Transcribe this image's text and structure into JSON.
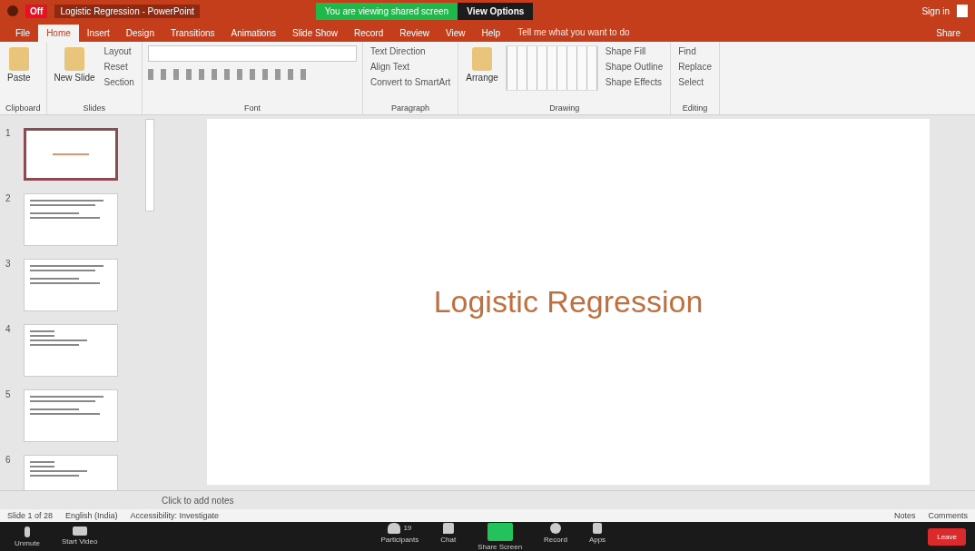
{
  "share_banner": {
    "message": "You are viewing shared screen",
    "options": "View Options"
  },
  "title_bar": {
    "save_badge": "Off",
    "title": "Logistic Regression - PowerPoint",
    "user": "Sign in"
  },
  "tabs": [
    {
      "label": "File",
      "selected": false
    },
    {
      "label": "Home",
      "selected": true
    },
    {
      "label": "Insert",
      "selected": false
    },
    {
      "label": "Design",
      "selected": false
    },
    {
      "label": "Transitions",
      "selected": false
    },
    {
      "label": "Animations",
      "selected": false
    },
    {
      "label": "Slide Show",
      "selected": false
    },
    {
      "label": "Record",
      "selected": false
    },
    {
      "label": "Review",
      "selected": false
    },
    {
      "label": "View",
      "selected": false
    },
    {
      "label": "Help",
      "selected": false
    }
  ],
  "tell_me": {
    "placeholder": "Tell me what you want to do"
  },
  "share_button": "Share",
  "ribbon": {
    "groups": [
      {
        "label": "Clipboard",
        "large": [
          "Paste"
        ]
      },
      {
        "label": "Slides",
        "large": [
          "New Slide"
        ],
        "small": [
          "Layout",
          "Reset",
          "Section"
        ]
      },
      {
        "label": "Font"
      },
      {
        "label": "Paragraph",
        "small": [
          "Text Direction",
          "Align Text",
          "Convert to SmartArt"
        ]
      },
      {
        "label": "Drawing",
        "large": [
          "Arrange"
        ],
        "small": [
          "Shape Fill",
          "Shape Outline",
          "Shape Effects"
        ]
      },
      {
        "label": "Editing",
        "small": [
          "Find",
          "Replace",
          "Select"
        ]
      }
    ]
  },
  "thumbnails": [
    {
      "number": "1",
      "selected": true,
      "kind": "title"
    },
    {
      "number": "2",
      "selected": false,
      "kind": "text"
    },
    {
      "number": "3",
      "selected": false,
      "kind": "text"
    },
    {
      "number": "4",
      "selected": false,
      "kind": "list"
    },
    {
      "number": "5",
      "selected": false,
      "kind": "text"
    },
    {
      "number": "6",
      "selected": false,
      "kind": "list"
    }
  ],
  "slide": {
    "title": "Logistic Regression"
  },
  "notes": {
    "placeholder": "Click to add notes"
  },
  "status_bar": {
    "left": [
      "Slide 1 of 28",
      "English (India)",
      "Accessibility: Investigate"
    ],
    "right": [
      "Notes",
      "Comments"
    ]
  },
  "meeting_bar": {
    "left": [
      {
        "label": "Unmute",
        "kind": "mic"
      },
      {
        "label": "Start Video",
        "kind": "video"
      }
    ],
    "center": [
      {
        "label": "Participants",
        "kind": "people",
        "count": "19"
      },
      {
        "label": "Chat",
        "kind": "chat"
      },
      {
        "label": "Share Screen",
        "kind": "share"
      },
      {
        "label": "Record",
        "kind": "record"
      },
      {
        "label": "Apps",
        "kind": "apps"
      }
    ],
    "end": "Leave"
  }
}
